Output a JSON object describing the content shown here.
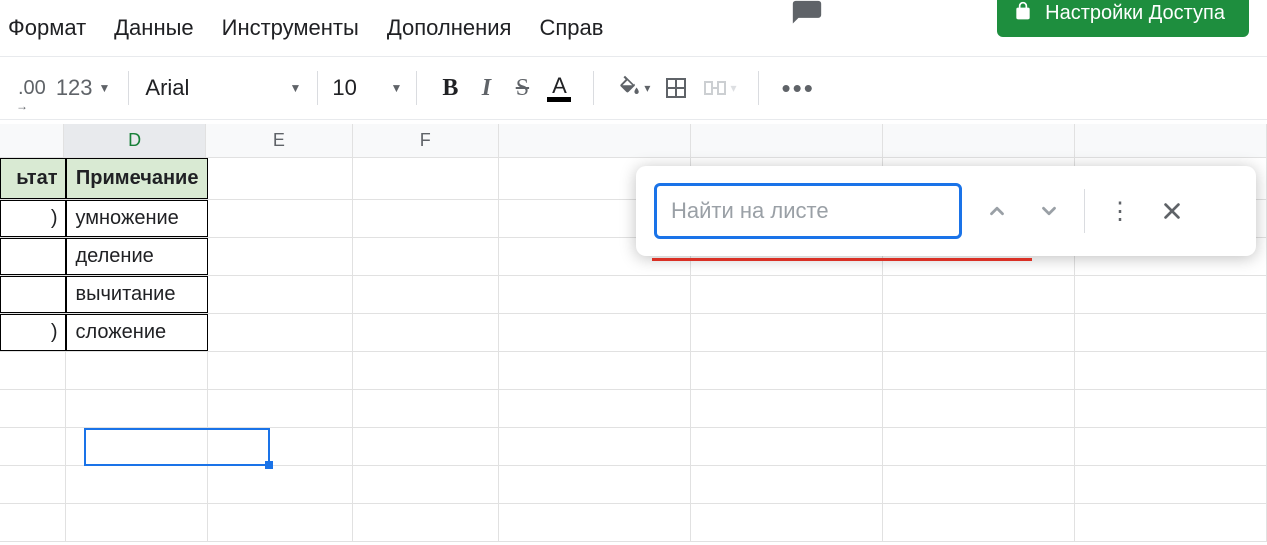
{
  "menu": {
    "format": "Формат",
    "data": "Данные",
    "tools": "Инструменты",
    "addons": "Дополнения",
    "help": "Справ"
  },
  "share": {
    "label": "Настройки Доступа"
  },
  "toolbar": {
    "dec_format": ".00",
    "number_format": "123",
    "font": "Arial",
    "size": "10",
    "bold": "B",
    "italic": "I",
    "strike": "S",
    "textcolor_letter": "A"
  },
  "columns": {
    "d": "D",
    "e": "E",
    "f": "F"
  },
  "table": {
    "headers": {
      "result": "ьтат",
      "note": "Примечание"
    },
    "rows": [
      {
        "result": ")",
        "note": "умножение"
      },
      {
        "result": "",
        "note": "деление"
      },
      {
        "result": "",
        "note": "вычитание"
      },
      {
        "result": ")",
        "note": "сложение"
      }
    ]
  },
  "find": {
    "placeholder": "Найти на листе"
  }
}
